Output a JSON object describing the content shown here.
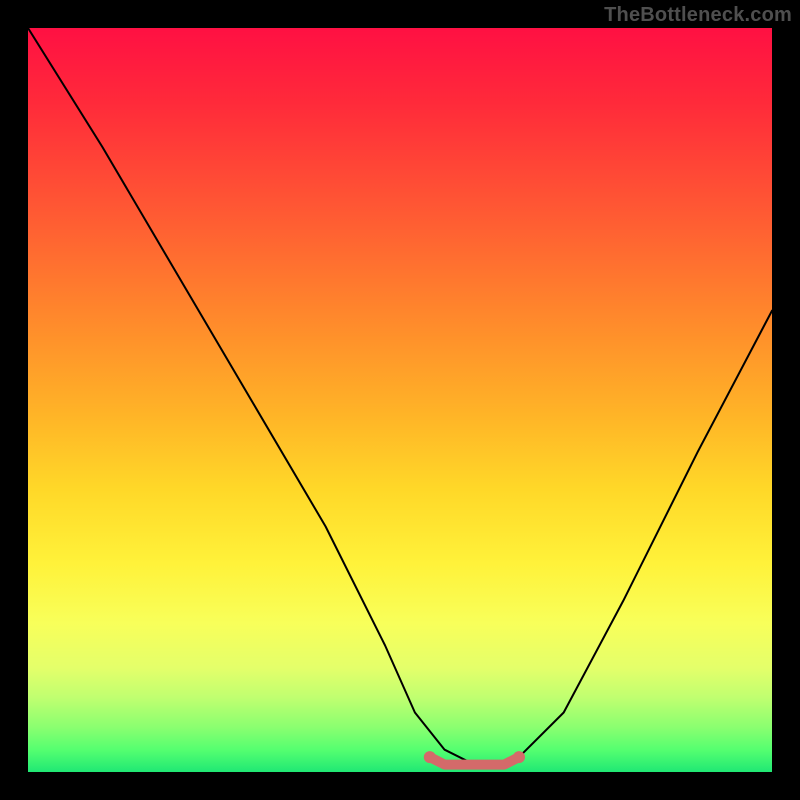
{
  "watermark": "TheBottleneck.com",
  "chart_data": {
    "type": "line",
    "title": "",
    "xlabel": "",
    "ylabel": "",
    "xlim": [
      0,
      100
    ],
    "ylim": [
      0,
      100
    ],
    "grid": false,
    "series": [
      {
        "name": "main-curve",
        "color": "#000000",
        "x": [
          0,
          10,
          20,
          30,
          40,
          48,
          52,
          56,
          60,
          63,
          66,
          72,
          80,
          90,
          100
        ],
        "values": [
          100,
          84,
          67,
          50,
          33,
          17,
          8,
          3,
          1,
          1,
          2,
          8,
          23,
          43,
          62
        ]
      },
      {
        "name": "bottom-segment",
        "color": "#d46a6a",
        "x": [
          54,
          56,
          58,
          60,
          62,
          64,
          66
        ],
        "values": [
          2,
          1,
          1,
          1,
          1,
          1,
          2
        ]
      }
    ],
    "background_gradient": {
      "direction": "top-to-bottom",
      "stops": [
        {
          "pos": 0,
          "color": "#ff1043"
        },
        {
          "pos": 25,
          "color": "#ff5a33"
        },
        {
          "pos": 50,
          "color": "#ffb427"
        },
        {
          "pos": 75,
          "color": "#fff23a"
        },
        {
          "pos": 90,
          "color": "#c0ff70"
        },
        {
          "pos": 100,
          "color": "#20e874"
        }
      ]
    }
  }
}
